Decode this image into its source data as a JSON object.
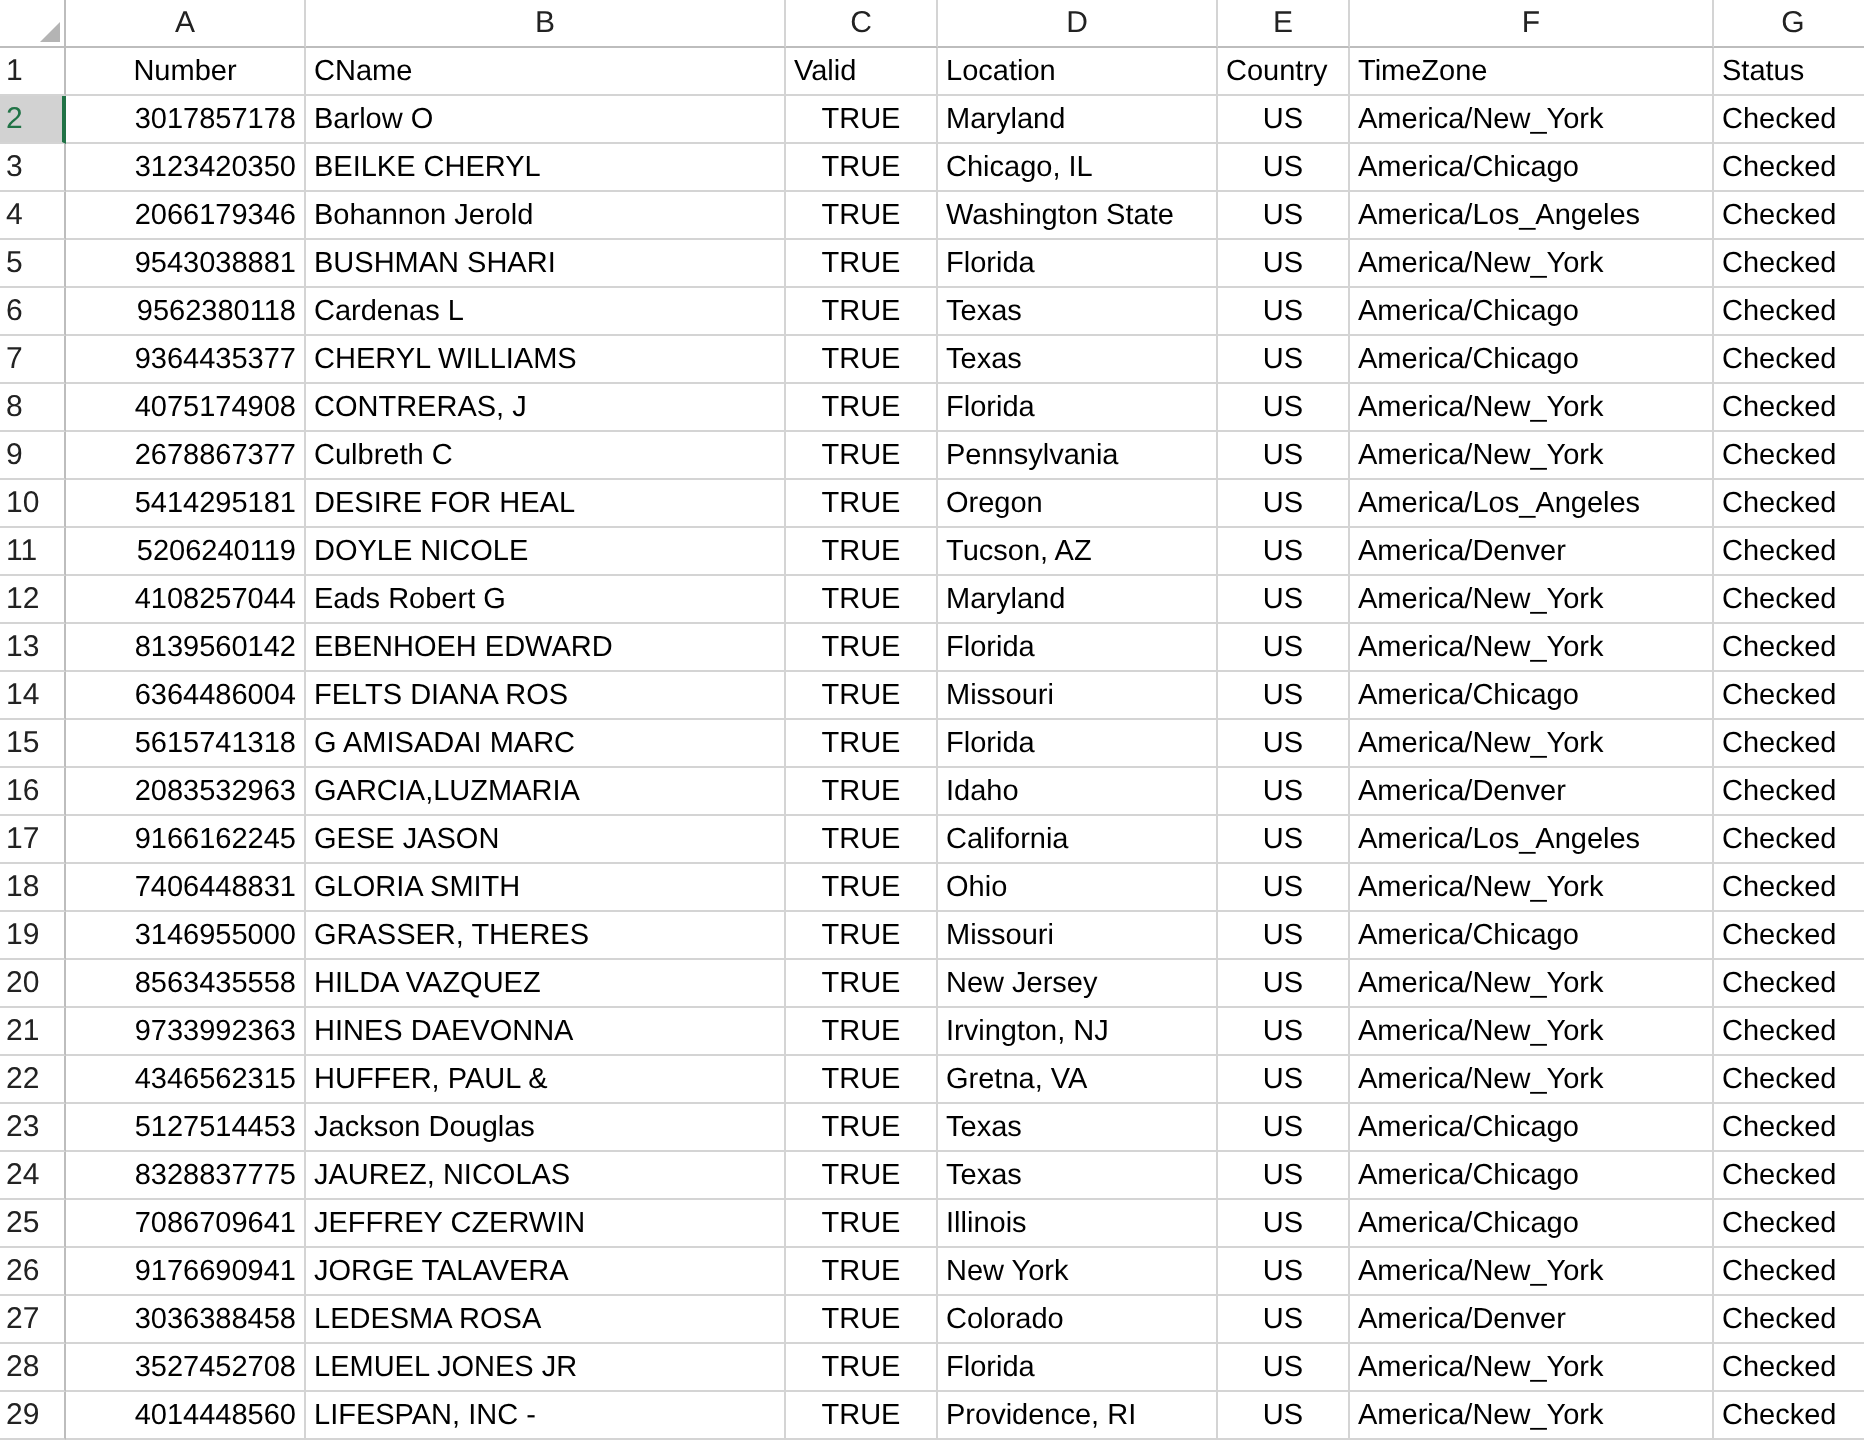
{
  "column_headers": [
    {
      "label": "A",
      "selected": false
    },
    {
      "label": "B",
      "selected": false
    },
    {
      "label": "C",
      "selected": false
    },
    {
      "label": "D",
      "selected": false
    },
    {
      "label": "E",
      "selected": false
    },
    {
      "label": "F",
      "selected": false
    },
    {
      "label": "G",
      "selected": false
    }
  ],
  "rows": [
    {
      "label": "1",
      "selected": false,
      "cells": [
        "Number",
        "CName",
        "Valid",
        "Location",
        "Country",
        "TimeZone",
        "Status"
      ]
    },
    {
      "label": "2",
      "selected": true,
      "cells": [
        "3017857178",
        "Barlow O",
        "TRUE",
        "Maryland",
        "US",
        "America/New_York",
        "Checked"
      ]
    },
    {
      "label": "3",
      "selected": false,
      "cells": [
        "3123420350",
        "BEILKE CHERYL",
        "TRUE",
        "Chicago, IL",
        "US",
        "America/Chicago",
        "Checked"
      ]
    },
    {
      "label": "4",
      "selected": false,
      "cells": [
        "2066179346",
        "Bohannon Jerold",
        "TRUE",
        "Washington State",
        "US",
        "America/Los_Angeles",
        "Checked"
      ]
    },
    {
      "label": "5",
      "selected": false,
      "cells": [
        "9543038881",
        "BUSHMAN SHARI",
        "TRUE",
        "Florida",
        "US",
        "America/New_York",
        "Checked"
      ]
    },
    {
      "label": "6",
      "selected": false,
      "cells": [
        "9562380118",
        "Cardenas L",
        "TRUE",
        "Texas",
        "US",
        "America/Chicago",
        "Checked"
      ]
    },
    {
      "label": "7",
      "selected": false,
      "cells": [
        "9364435377",
        "CHERYL WILLIAMS",
        "TRUE",
        "Texas",
        "US",
        "America/Chicago",
        "Checked"
      ]
    },
    {
      "label": "8",
      "selected": false,
      "cells": [
        "4075174908",
        "CONTRERAS, J",
        "TRUE",
        "Florida",
        "US",
        "America/New_York",
        "Checked"
      ]
    },
    {
      "label": "9",
      "selected": false,
      "cells": [
        "2678867377",
        "Culbreth C",
        "TRUE",
        "Pennsylvania",
        "US",
        "America/New_York",
        "Checked"
      ]
    },
    {
      "label": "10",
      "selected": false,
      "cells": [
        "5414295181",
        "DESIRE FOR HEAL",
        "TRUE",
        "Oregon",
        "US",
        "America/Los_Angeles",
        "Checked"
      ]
    },
    {
      "label": "11",
      "selected": false,
      "cells": [
        "5206240119",
        "DOYLE NICOLE",
        "TRUE",
        "Tucson, AZ",
        "US",
        "America/Denver",
        "Checked"
      ]
    },
    {
      "label": "12",
      "selected": false,
      "cells": [
        "4108257044",
        "Eads Robert G",
        "TRUE",
        "Maryland",
        "US",
        "America/New_York",
        "Checked"
      ]
    },
    {
      "label": "13",
      "selected": false,
      "cells": [
        "8139560142",
        "EBENHOEH EDWARD",
        "TRUE",
        "Florida",
        "US",
        "America/New_York",
        "Checked"
      ]
    },
    {
      "label": "14",
      "selected": false,
      "cells": [
        "6364486004",
        "FELTS DIANA ROS",
        "TRUE",
        "Missouri",
        "US",
        "America/Chicago",
        "Checked"
      ]
    },
    {
      "label": "15",
      "selected": false,
      "cells": [
        "5615741318",
        "G AMISADAI MARC",
        "TRUE",
        "Florida",
        "US",
        "America/New_York",
        "Checked"
      ]
    },
    {
      "label": "16",
      "selected": false,
      "cells": [
        "2083532963",
        "GARCIA,LUZMARIA",
        "TRUE",
        "Idaho",
        "US",
        "America/Denver",
        "Checked"
      ]
    },
    {
      "label": "17",
      "selected": false,
      "cells": [
        "9166162245",
        "GESE JASON",
        "TRUE",
        "California",
        "US",
        "America/Los_Angeles",
        "Checked"
      ]
    },
    {
      "label": "18",
      "selected": false,
      "cells": [
        "7406448831",
        "GLORIA SMITH",
        "TRUE",
        "Ohio",
        "US",
        "America/New_York",
        "Checked"
      ]
    },
    {
      "label": "19",
      "selected": false,
      "cells": [
        "3146955000",
        "GRASSER, THERES",
        "TRUE",
        "Missouri",
        "US",
        "America/Chicago",
        "Checked"
      ]
    },
    {
      "label": "20",
      "selected": false,
      "cells": [
        "8563435558",
        "HILDA VAZQUEZ",
        "TRUE",
        "New Jersey",
        "US",
        "America/New_York",
        "Checked"
      ]
    },
    {
      "label": "21",
      "selected": false,
      "cells": [
        "9733992363",
        "HINES DAEVONNA",
        "TRUE",
        "Irvington, NJ",
        "US",
        "America/New_York",
        "Checked"
      ]
    },
    {
      "label": "22",
      "selected": false,
      "cells": [
        "4346562315",
        "HUFFER, PAUL &",
        "TRUE",
        "Gretna, VA",
        "US",
        "America/New_York",
        "Checked"
      ]
    },
    {
      "label": "23",
      "selected": false,
      "cells": [
        "5127514453",
        "Jackson Douglas",
        "TRUE",
        "Texas",
        "US",
        "America/Chicago",
        "Checked"
      ]
    },
    {
      "label": "24",
      "selected": false,
      "cells": [
        "8328837775",
        "JAUREZ, NICOLAS",
        "TRUE",
        "Texas",
        "US",
        "America/Chicago",
        "Checked"
      ]
    },
    {
      "label": "25",
      "selected": false,
      "cells": [
        "7086709641",
        "JEFFREY CZERWIN",
        "TRUE",
        "Illinois",
        "US",
        "America/Chicago",
        "Checked"
      ]
    },
    {
      "label": "26",
      "selected": false,
      "cells": [
        "9176690941",
        "JORGE TALAVERA",
        "TRUE",
        "New York",
        "US",
        "America/New_York",
        "Checked"
      ]
    },
    {
      "label": "27",
      "selected": false,
      "cells": [
        "3036388458",
        "LEDESMA ROSA",
        "TRUE",
        "Colorado",
        "US",
        "America/Denver",
        "Checked"
      ]
    },
    {
      "label": "28",
      "selected": false,
      "cells": [
        "3527452708",
        "LEMUEL JONES JR",
        "TRUE",
        "Florida",
        "US",
        "America/New_York",
        "Checked"
      ]
    },
    {
      "label": "29",
      "selected": false,
      "cells": [
        "4014448560",
        "LIFESPAN, INC -",
        "TRUE",
        "Providence, RI",
        "US",
        "America/New_York",
        "Checked"
      ]
    }
  ]
}
